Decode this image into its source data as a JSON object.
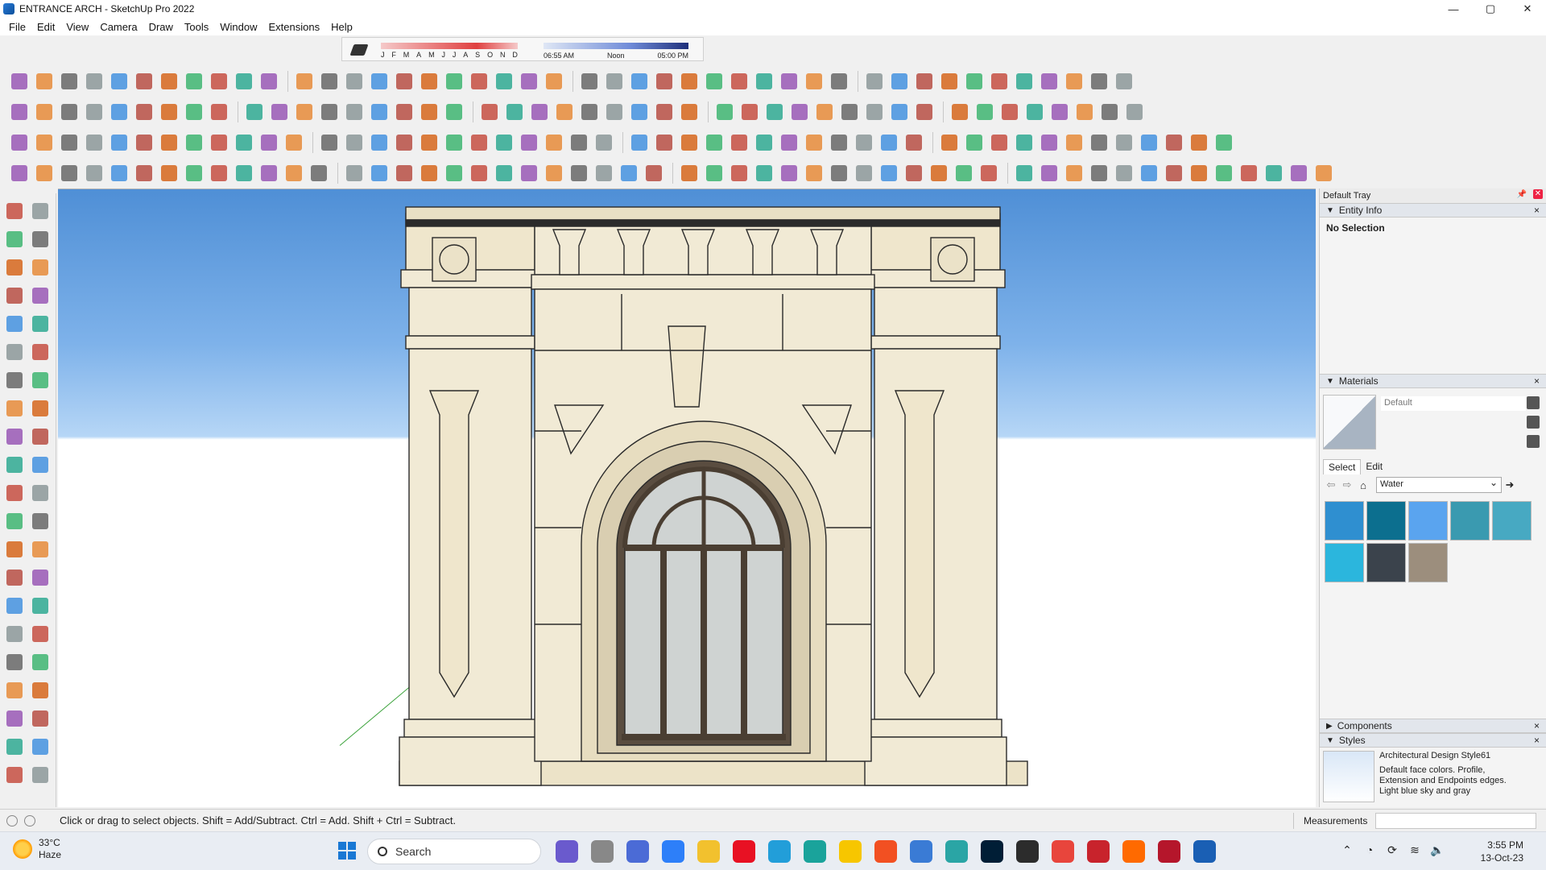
{
  "window": {
    "title": "ENTRANCE ARCH - SketchUp Pro 2022",
    "controls": {
      "minimize": "—",
      "maximize": "▢",
      "close": "✕"
    }
  },
  "menu": [
    "File",
    "Edit",
    "View",
    "Camera",
    "Draw",
    "Tools",
    "Window",
    "Extensions",
    "Help"
  ],
  "shadows": {
    "months": [
      "J",
      "F",
      "M",
      "A",
      "M",
      "J",
      "J",
      "A",
      "S",
      "O",
      "N",
      "D"
    ],
    "time_start": "06:55 AM",
    "time_mid": "Noon",
    "time_end": "05:00 PM"
  },
  "tray": {
    "title": "Default Tray",
    "entity_info": {
      "label": "Entity Info",
      "value": "No Selection"
    },
    "materials": {
      "label": "Materials",
      "current": "Default",
      "tab_select": "Select",
      "tab_edit": "Edit",
      "library": "Water",
      "swatch_colors": [
        "#2f8fd0",
        "#0c6f8f",
        "#5aa4ef",
        "#3a9ab0",
        "#47a9c2",
        "#2bb6dd",
        "#3b434c",
        "#9c8e7d"
      ]
    },
    "components": {
      "label": "Components"
    },
    "styles": {
      "label": "Styles",
      "name": "Architectural Design Style61",
      "description": "Default face colors. Profile, Extension and Endpoints edges. Light blue sky and gray"
    }
  },
  "status": {
    "hint": "Click or drag to select objects. Shift = Add/Subtract. Ctrl = Add. Shift + Ctrl = Subtract.",
    "measurements_label": "Measurements"
  },
  "taskbar": {
    "weather_temp": "33°C",
    "weather_desc": "Haze",
    "search": "Search",
    "time": "3:55 PM",
    "date": "13-Oct-23"
  }
}
